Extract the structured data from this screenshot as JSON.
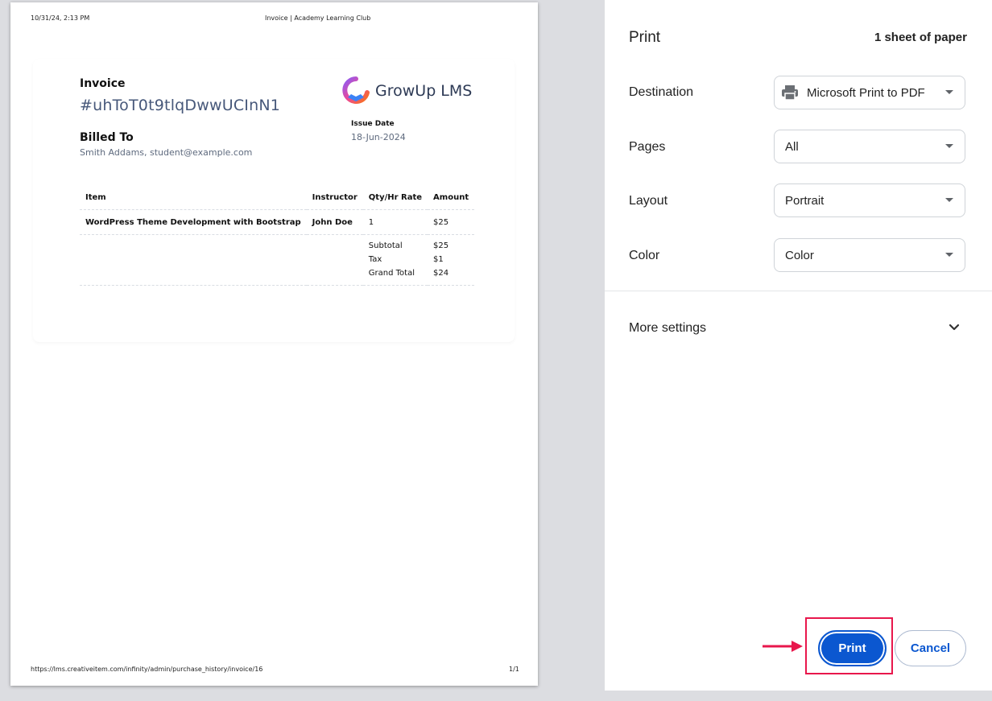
{
  "preview": {
    "header_date": "10/31/24, 2:13 PM",
    "header_title": "Invoice | Academy Learning Club",
    "footer_url": "https://lms.creativeitem.com/infinity/admin/purchase_history/invoice/16",
    "footer_page": "1/1",
    "invoice": {
      "label": "Invoice",
      "id": "#uhToT0t9tlqDwwUCInN1",
      "billed_to_label": "Billed To",
      "billed_to_value": "Smith Addams, student@example.com",
      "logo_text": "GrowUp LMS",
      "issue_date_label": "Issue Date",
      "issue_date_value": "18-Jun-2024",
      "table": {
        "headers": [
          "Item",
          "Instructor",
          "Qty/Hr Rate",
          "Amount"
        ],
        "rows": [
          {
            "item": "WordPress Theme Development with Bootstrap",
            "instructor": "John Doe",
            "qty": "1",
            "amount": "$25"
          }
        ],
        "summary": [
          {
            "label": "Subtotal",
            "value": "$25"
          },
          {
            "label": "Tax",
            "value": "$1"
          },
          {
            "label": "Grand Total",
            "value": "$24"
          }
        ]
      }
    }
  },
  "settings": {
    "title": "Print",
    "sheets": "1 sheet of paper",
    "destination": {
      "label": "Destination",
      "value": "Microsoft Print to PDF"
    },
    "pages": {
      "label": "Pages",
      "value": "All"
    },
    "layout": {
      "label": "Layout",
      "value": "Portrait"
    },
    "color": {
      "label": "Color",
      "value": "Color"
    },
    "more_settings": "More settings",
    "print_button": "Print",
    "cancel_button": "Cancel",
    "accent_color": "#0b57d0",
    "highlight_color": "#e8174c"
  }
}
